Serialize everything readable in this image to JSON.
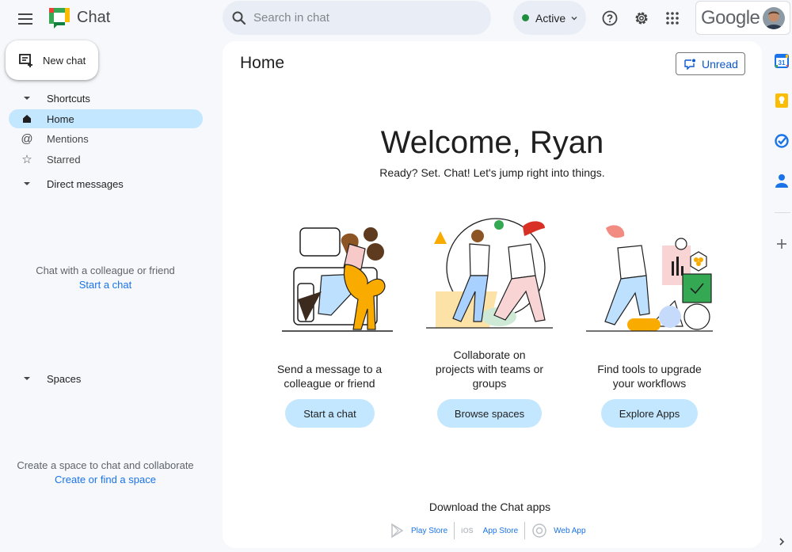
{
  "app": {
    "title": "Chat"
  },
  "search": {
    "placeholder": "Search in chat"
  },
  "status": {
    "label": "Active",
    "color": "#1e8e3e"
  },
  "account": {
    "brand": "Google"
  },
  "sidebar": {
    "new_chat": "New chat",
    "shortcuts": {
      "label": "Shortcuts",
      "items": [
        {
          "label": "Home",
          "icon": "home-icon",
          "active": true
        },
        {
          "label": "Mentions",
          "icon": "at-icon",
          "active": false
        },
        {
          "label": "Starred",
          "icon": "star-icon",
          "active": false
        }
      ]
    },
    "direct_messages": {
      "label": "Direct messages",
      "empty_text": "Chat with a colleague or friend",
      "empty_link": "Start a chat"
    },
    "spaces": {
      "label": "Spaces",
      "empty_text": "Create a space to chat and collaborate",
      "empty_link": "Create or find a space"
    }
  },
  "main": {
    "title": "Home",
    "unread_button": "Unread",
    "welcome": "Welcome, Ryan",
    "subtitle": "Ready? Set. Chat! Let's jump right into things.",
    "columns": [
      {
        "line1": "Send a message to a",
        "line2": "colleague or friend",
        "line3": "",
        "button": "Start a chat"
      },
      {
        "line1": "Collaborate on",
        "line2": "projects with teams or",
        "line3": "groups",
        "button": "Browse spaces"
      },
      {
        "line1": "Find tools to upgrade",
        "line2": "your workflows",
        "line3": "",
        "button": "Explore Apps"
      }
    ],
    "download": {
      "title": "Download the Chat apps",
      "ios_label": "iOS",
      "stores": [
        "Play Store",
        "App Store",
        "Web App"
      ]
    }
  },
  "colors": {
    "accent": "#c2e7ff",
    "link": "#1a73e8",
    "background": "#f6f8fc"
  }
}
